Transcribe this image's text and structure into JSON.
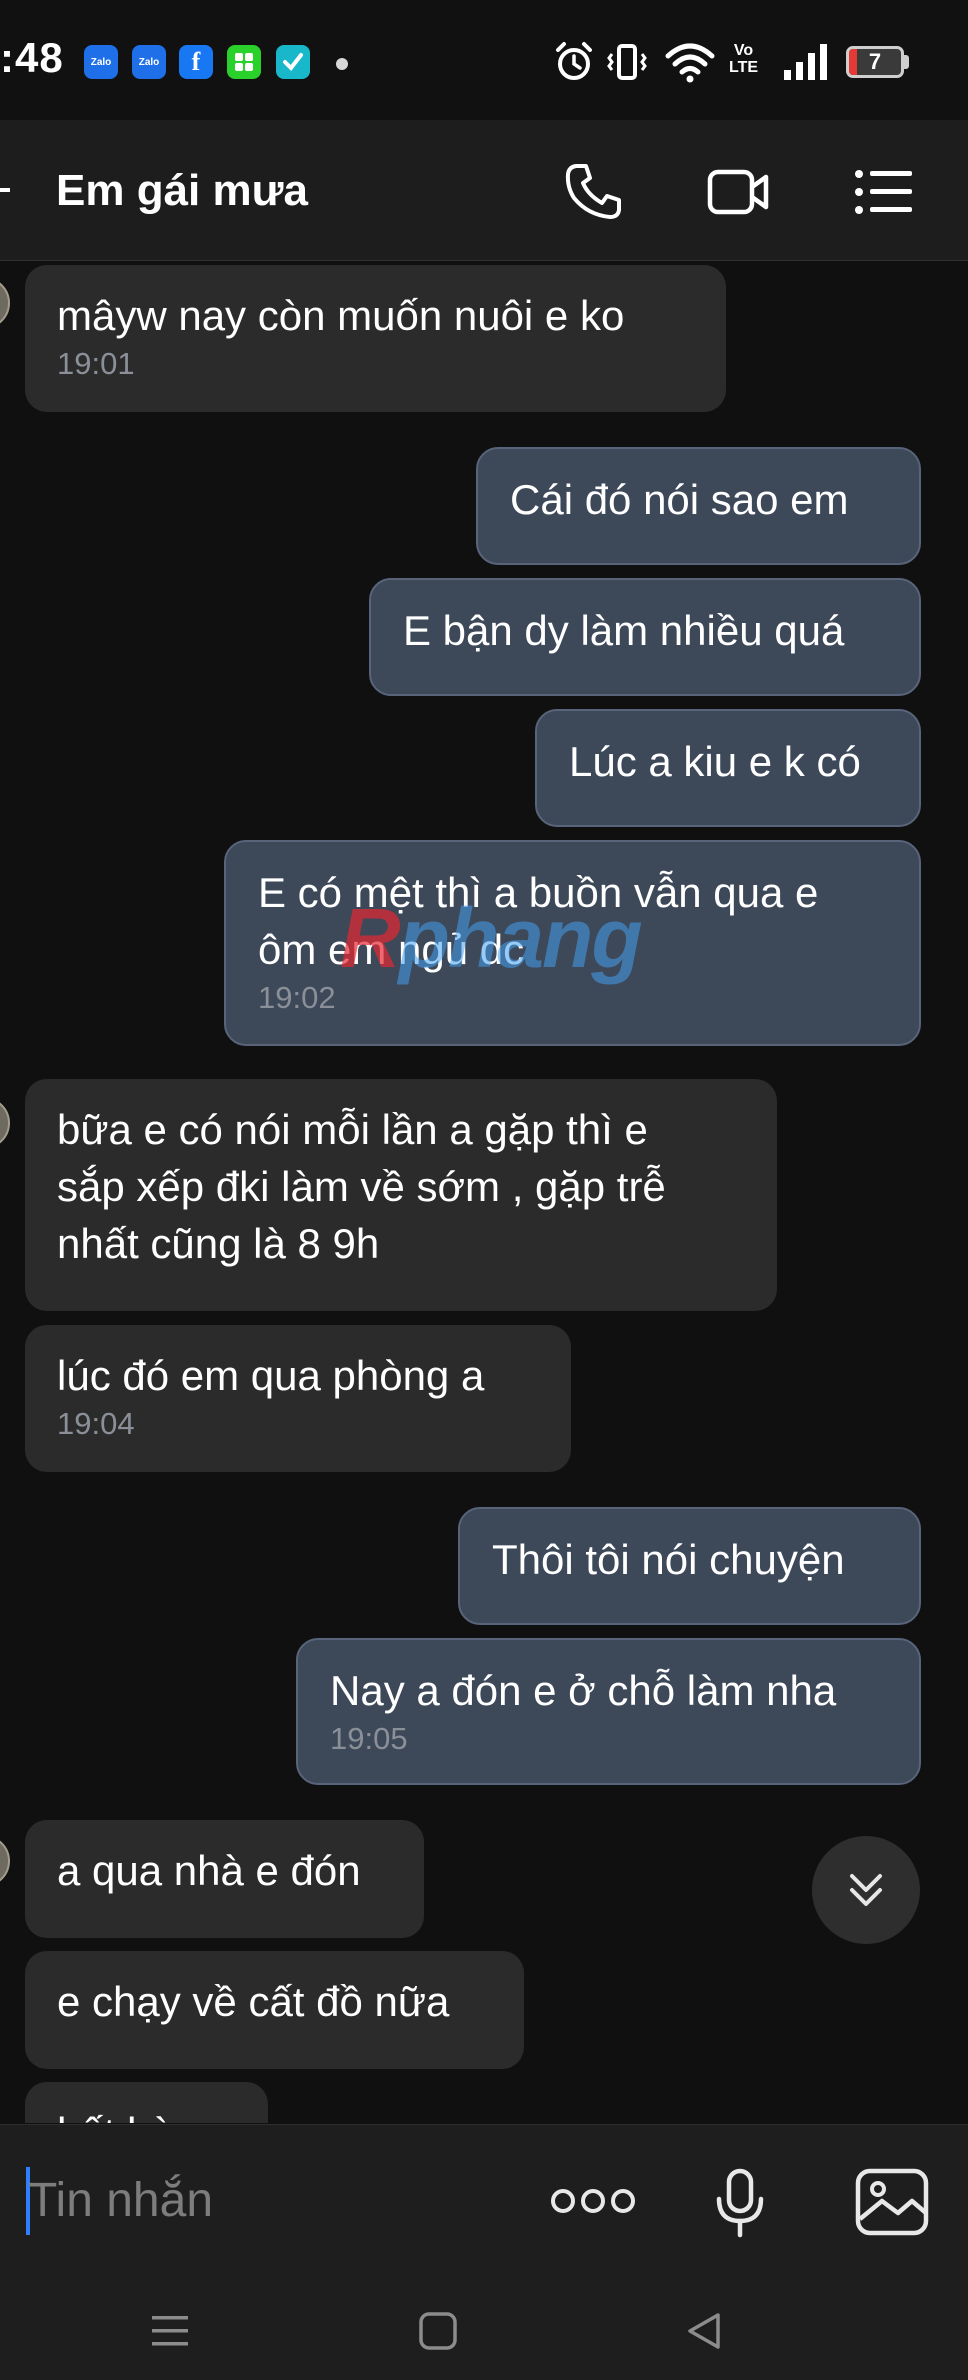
{
  "status_bar": {
    "time": ":48",
    "notification_icons": [
      "zalo-icon",
      "zalo-icon",
      "facebook-icon",
      "green-app-icon",
      "checklist-icon"
    ],
    "zalo_label": "Zalo",
    "facebook_label": "f",
    "network_label_1": "Vo",
    "network_label_2": "LTE",
    "battery_level": "7",
    "battery_color": "#e53935"
  },
  "header": {
    "title": "Em gái mưa",
    "actions": [
      "phone-icon",
      "video-call-icon",
      "menu-list-icon"
    ]
  },
  "messages": [
    {
      "dir": "in",
      "lines": [
        "mâyw nay còn muốn nuôi e ko"
      ],
      "time": "19:01"
    },
    {
      "dir": "out",
      "lines": [
        "Cái đó nói sao em"
      ],
      "time": ""
    },
    {
      "dir": "out",
      "lines": [
        "E bận dy làm nhiều quá"
      ],
      "time": ""
    },
    {
      "dir": "out",
      "lines": [
        "Lúc a kiu e k có"
      ],
      "time": ""
    },
    {
      "dir": "out",
      "lines": [
        "E có mệt thì a buồn vẫn qua e",
        "ôm em ngủ dc"
      ],
      "time": "19:02"
    },
    {
      "dir": "in",
      "lines": [
        "bữa e có nói mỗi lần a gặp thì e",
        "sắp xếp đki làm về sớm , gặp trễ",
        "nhất cũng là 8 9h"
      ],
      "time": ""
    },
    {
      "dir": "in",
      "lines": [
        "lúc đó em qua phòng a"
      ],
      "time": "19:04"
    },
    {
      "dir": "out",
      "lines": [
        "Thôi tôi nói chuyện"
      ],
      "time": ""
    },
    {
      "dir": "out",
      "lines": [
        "Nay a đón e ở chỗ làm nha"
      ],
      "time": "19:05"
    },
    {
      "dir": "in",
      "lines": [
        "a qua nhà e đón"
      ],
      "time": ""
    },
    {
      "dir": "in",
      "lines": [
        "e chạy về cất đồ nữa"
      ],
      "time": ""
    },
    {
      "dir": "in",
      "lines": [
        "hết hàng"
      ],
      "time": ""
    }
  ],
  "watermark": {
    "first": "R",
    "rest": "phang"
  },
  "composer": {
    "placeholder": "Tin nhắn",
    "buttons": [
      "more-options-icon",
      "microphone-icon",
      "image-icon"
    ]
  },
  "colors": {
    "incoming_bubble": "#2b2b2b",
    "outgoing_bubble": "#3d4859",
    "accent": "#2f80ff",
    "background": "#101010"
  }
}
